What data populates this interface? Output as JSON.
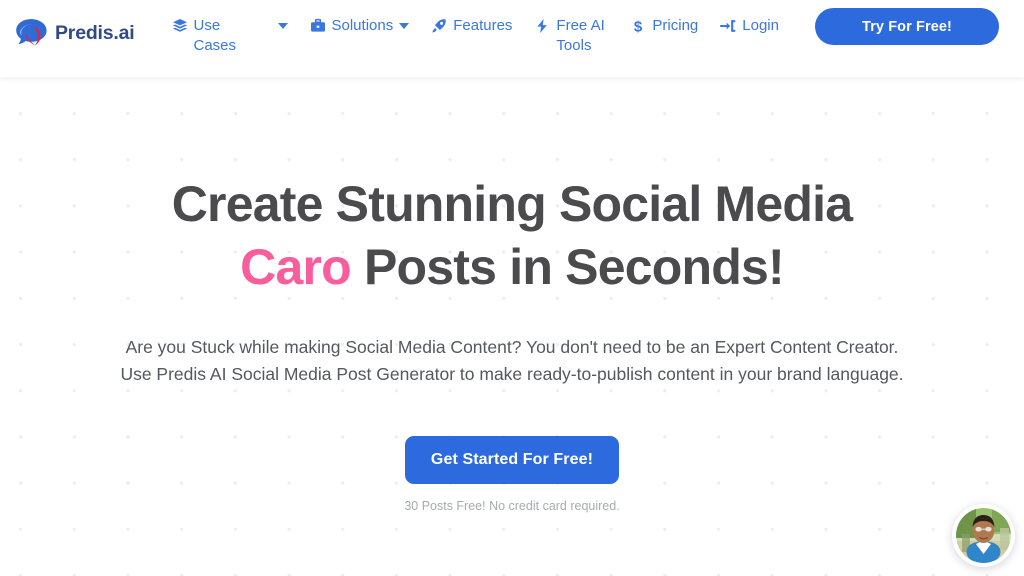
{
  "header": {
    "brand": {
      "name": "Predis.ai",
      "logo_icon": "speech-bubble-logo-icon"
    },
    "nav": [
      {
        "label": "Use Cases",
        "icon": "layers-icon",
        "has_caret": true,
        "caret_detached": true
      },
      {
        "label": "Solutions",
        "icon": "briefcase-icon",
        "has_caret": true,
        "caret_detached": false
      },
      {
        "label": "Features",
        "icon": "rocket-icon",
        "has_caret": false
      },
      {
        "label": "Free AI Tools",
        "icon": "lightning-bolt-icon",
        "has_caret": false
      },
      {
        "label": "Pricing",
        "icon": "dollar-sign-icon",
        "has_caret": false
      },
      {
        "label": "Login",
        "icon": "sign-in-icon",
        "has_caret": false
      }
    ],
    "try_button_label": "Try For Free!"
  },
  "hero": {
    "headline_line1": "Create Stunning Social Media",
    "headline_accent": "Caro",
    "headline_line2_rest": " Posts in Seconds!",
    "subhead_line1": "Are you Stuck while making Social Media Content? You don't need to be an Expert Content Creator.",
    "subhead_line2": "Use Predis AI Social Media Post Generator to make ready-to-publish content in your brand language.",
    "cta_label": "Get Started For Free!",
    "cta_note": "30 Posts Free! No credit card required."
  },
  "widget": {
    "avatar_icon": "user-avatar-photo"
  },
  "colors": {
    "brand_blue": "#2d6ade",
    "nav_blue": "#3b77dd",
    "accent_pink": "#fa5d9b",
    "headline_gray": "#4b4b4e",
    "body_gray": "#54585f",
    "note_gray": "#a8abb1",
    "brand_text": "#2f4a86"
  }
}
